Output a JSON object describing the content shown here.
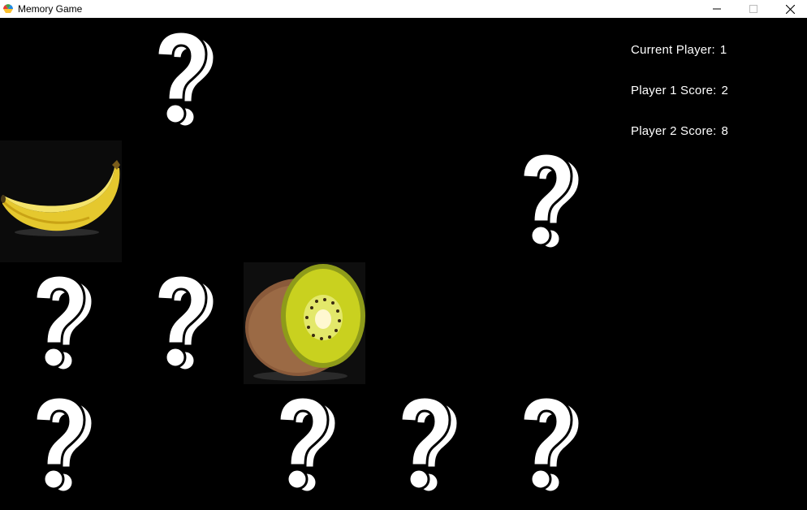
{
  "window": {
    "title": "Memory Game",
    "icon": "memory-game-app-icon",
    "controls": [
      "minimize-icon",
      "maximize-icon",
      "close-icon"
    ]
  },
  "hud": {
    "current_player_label": "Current Player:",
    "current_player_value": "1",
    "player1_label": "Player 1 Score:",
    "player1_value": "2",
    "player2_label": "Player 2 Score:",
    "player2_value": "8"
  },
  "board": {
    "rows": 4,
    "columns": 5,
    "cards": [
      {
        "row": 0,
        "col": 0,
        "state": "matched"
      },
      {
        "row": 0,
        "col": 1,
        "state": "hidden",
        "face": "question-mark"
      },
      {
        "row": 0,
        "col": 2,
        "state": "matched"
      },
      {
        "row": 0,
        "col": 3,
        "state": "matched"
      },
      {
        "row": 0,
        "col": 4,
        "state": "matched"
      },
      {
        "row": 1,
        "col": 0,
        "state": "revealed",
        "face": "banana"
      },
      {
        "row": 1,
        "col": 1,
        "state": "matched"
      },
      {
        "row": 1,
        "col": 2,
        "state": "matched"
      },
      {
        "row": 1,
        "col": 3,
        "state": "matched"
      },
      {
        "row": 1,
        "col": 4,
        "state": "hidden",
        "face": "question-mark"
      },
      {
        "row": 2,
        "col": 0,
        "state": "hidden",
        "face": "question-mark"
      },
      {
        "row": 2,
        "col": 1,
        "state": "hidden",
        "face": "question-mark"
      },
      {
        "row": 2,
        "col": 2,
        "state": "revealed",
        "face": "kiwi"
      },
      {
        "row": 2,
        "col": 3,
        "state": "matched"
      },
      {
        "row": 2,
        "col": 4,
        "state": "matched"
      },
      {
        "row": 3,
        "col": 0,
        "state": "hidden",
        "face": "question-mark"
      },
      {
        "row": 3,
        "col": 1,
        "state": "matched"
      },
      {
        "row": 3,
        "col": 2,
        "state": "hidden",
        "face": "question-mark"
      },
      {
        "row": 3,
        "col": 3,
        "state": "hidden",
        "face": "question-mark"
      },
      {
        "row": 3,
        "col": 4,
        "state": "hidden",
        "face": "question-mark"
      }
    ]
  },
  "colors": {
    "background": "#000000",
    "text": "#ffffff",
    "titlebar": "#ffffff"
  }
}
